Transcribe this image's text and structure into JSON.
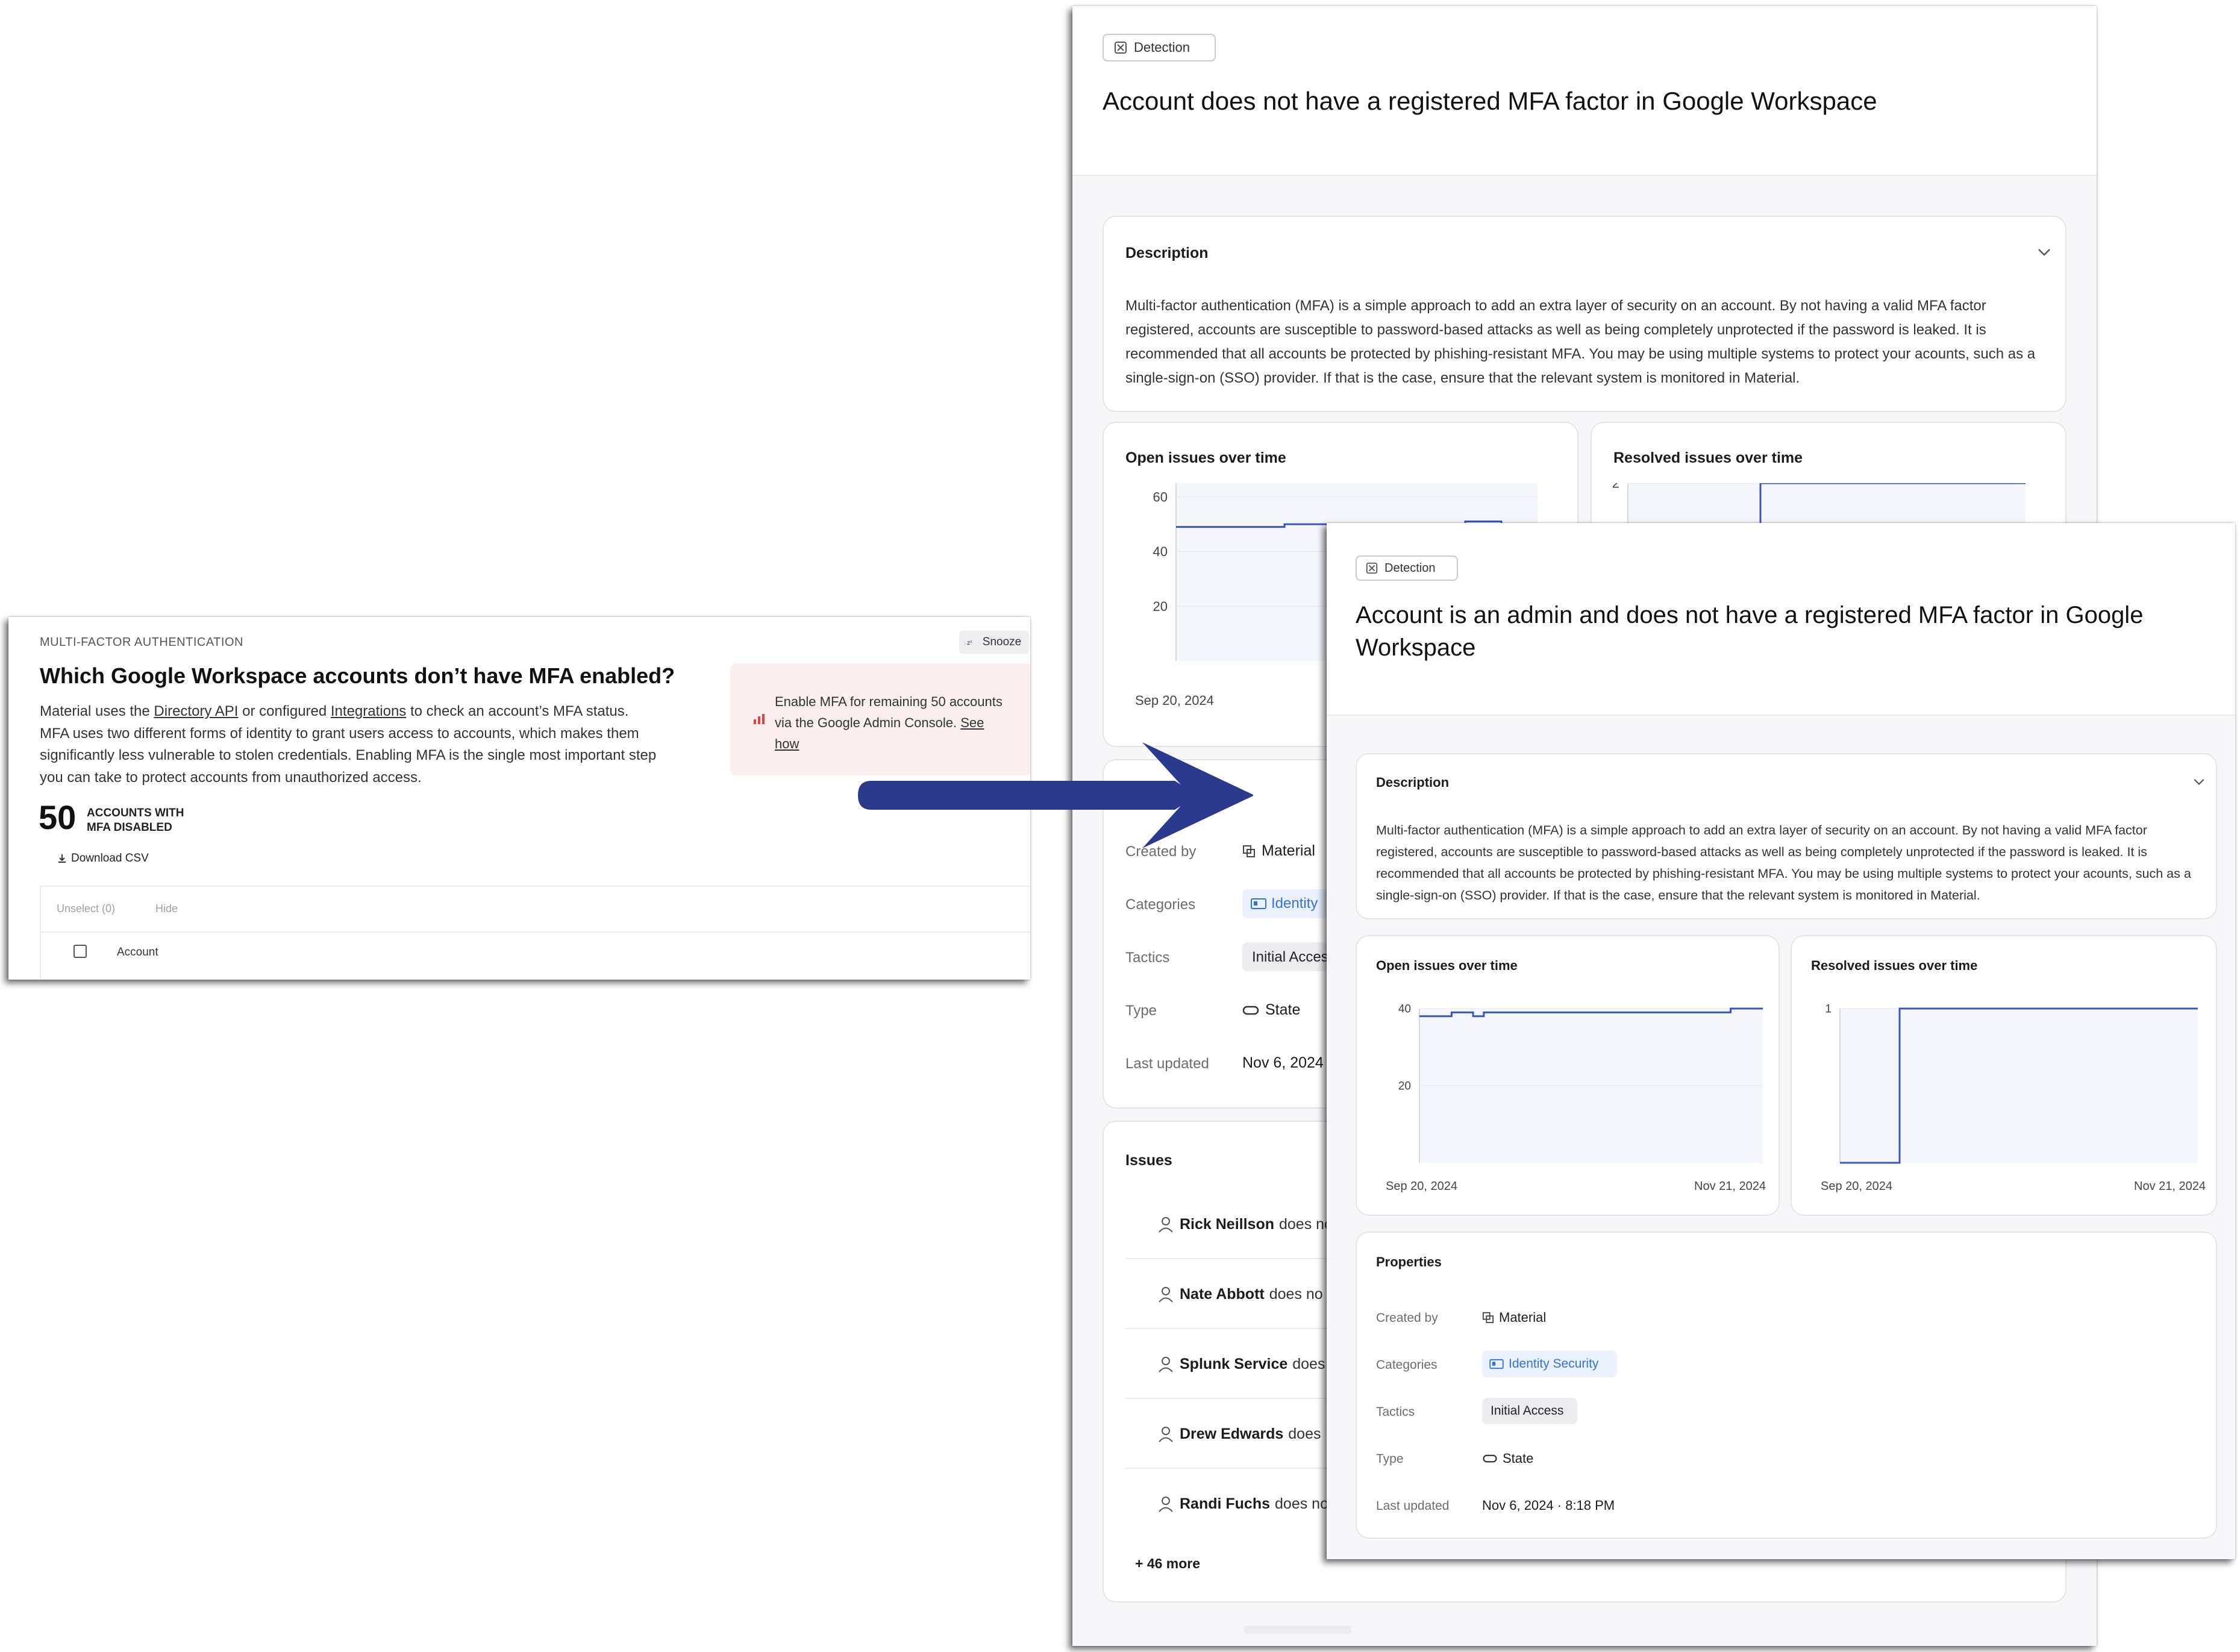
{
  "left_card": {
    "section_label": "MULTI-FACTOR AUTHENTICATION",
    "title": "Which Google Workspace accounts don’t have MFA enabled?",
    "desc_1": "Material uses the ",
    "desc_link_1": "Directory API",
    "desc_2": " or configured ",
    "desc_link_2": "Integrations",
    "desc_3": " to check an account’s MFA status. MFA uses two different forms of identity to grant users access to accounts, which makes them significantly less vulnerable to stolen credentials. Enabling MFA is the single most important step you can take to protect accounts from unauthorized access.",
    "snooze_label": "Snooze",
    "callout_text": "Enable MFA for remaining 50 accounts via the Google Admin Console.",
    "callout_link": "See how",
    "stat_value": "50",
    "stat_label_1": "ACCOUNTS WITH",
    "stat_label_2": "MFA DISABLED",
    "download_label": "Download CSV",
    "unselect_label": "Unselect (0)",
    "hide_label": "Hide",
    "col_account": "Account"
  },
  "detection_1": {
    "badge": "Detection",
    "title": "Account does not have a registered MFA factor in Google Workspace",
    "description_heading": "Description",
    "description_text": "Multi-factor authentication (MFA) is a simple approach to add an extra layer of security on an account. By not having a valid MFA factor registered, accounts are susceptible to password-based attacks as well as being completely unprotected if the password is leaked. It is recommended that all accounts be protected by phishing-resistant MFA. You may be using multiple systems to protect your acounts, such as a single-sign-on (SSO) provider. If that is the case, ensure that the relevant system is monitored in Material.",
    "open_chart_title": "Open issues over time",
    "resolved_chart_title": "Resolved issues over time",
    "open_x_start": "Sep 20, 2024",
    "props": {
      "created_by_label": "Created by",
      "created_by_value": "Material",
      "categories_label": "Categories",
      "categories_value": "Identity",
      "tactics_label": "Tactics",
      "tactics_value": "Initial Acces",
      "type_label": "Type",
      "type_value": "State",
      "updated_label": "Last updated",
      "updated_value": "Nov 6, 2024"
    },
    "issues_heading": "Issues",
    "issues": [
      {
        "name": "Rick Neillson",
        "rest": "does no"
      },
      {
        "name": "Nate Abbott",
        "rest": "does no"
      },
      {
        "name": "Splunk Service",
        "rest": "does"
      },
      {
        "name": "Drew Edwards",
        "rest": "does"
      },
      {
        "name": "Randi Fuchs",
        "rest": "does no"
      }
    ],
    "more": "+ 46 more"
  },
  "detection_2": {
    "badge": "Detection",
    "title_line_1": "Account is an admin and does not have a registered MFA factor in Google",
    "title_line_2": "Workspace",
    "description_heading": "Description",
    "description_text": "Multi-factor authentication (MFA) is a simple approach to add an extra layer of security on an account. By not having a valid MFA factor registered, accounts are susceptible to password-based attacks as well as being completely unprotected if the password is leaked. It is recommended that all accounts be protected by phishing-resistant MFA. You may be using multiple systems to protect your acounts, such as a single-sign-on (SSO) provider. If that is the case, ensure that the relevant system is monitored in Material.",
    "open_chart_title": "Open issues over time",
    "resolved_chart_title": "Resolved issues over time",
    "properties_heading": "Properties",
    "props": {
      "created_by_label": "Created by",
      "created_by_value": "Material",
      "categories_label": "Categories",
      "categories_value": "Identity Security",
      "tactics_label": "Tactics",
      "tactics_value": "Initial Access",
      "type_label": "Type",
      "type_value": "State",
      "updated_label": "Last updated",
      "updated_value": "Nov 6, 2024 · 8:18 PM"
    }
  },
  "colors": {
    "line": "#3a55c0",
    "arrow": "#2b3a8c",
    "callout_bg": "#fbeeee",
    "tag_blue": "#3373d6"
  },
  "chart_data": [
    {
      "type": "line",
      "title": "Open issues over time",
      "x_labels": [
        "Sep 20, 2024"
      ],
      "yticks": [
        20,
        40,
        60
      ],
      "ylim": [
        0,
        65
      ],
      "series": [
        {
          "values": [
            49,
            49,
            49,
            50,
            50,
            50,
            50,
            50,
            51,
            50,
            50
          ]
        }
      ]
    },
    {
      "type": "line",
      "title": "Resolved issues over time",
      "yticks": [
        2
      ],
      "ylim": [
        0,
        2
      ],
      "series": [
        {
          "values": [
            0,
            0,
            0,
            0,
            0,
            2,
            2,
            2,
            2,
            2,
            2,
            2,
            2,
            2,
            2,
            2
          ]
        }
      ]
    },
    {
      "type": "line",
      "title": "Open issues over time",
      "x_labels": [
        "Sep 20, 2024",
        "Nov 21, 2024"
      ],
      "yticks": [
        20,
        40
      ],
      "ylim": [
        0,
        40
      ],
      "series": [
        {
          "values": [
            38,
            38,
            38,
            39,
            39,
            38,
            39,
            39,
            39,
            39,
            39,
            39,
            39,
            39,
            39,
            39,
            39,
            39,
            39,
            39,
            39,
            39,
            39,
            39,
            39,
            39,
            39,
            39,
            39,
            40,
            40,
            40,
            40
          ]
        }
      ]
    },
    {
      "type": "line",
      "title": "Resolved issues over time",
      "x_labels": [
        "Sep 20, 2024",
        "Nov 21, 2024"
      ],
      "yticks": [
        1
      ],
      "ylim": [
        0,
        1
      ],
      "series": [
        {
          "values": [
            0,
            0,
            0,
            0,
            0,
            0,
            1,
            1,
            1,
            1,
            1,
            1,
            1,
            1,
            1,
            1,
            1,
            1,
            1,
            1,
            1,
            1,
            1,
            1,
            1,
            1,
            1,
            1,
            1,
            1,
            1,
            1,
            1,
            1,
            1,
            1,
            1
          ]
        }
      ]
    }
  ]
}
